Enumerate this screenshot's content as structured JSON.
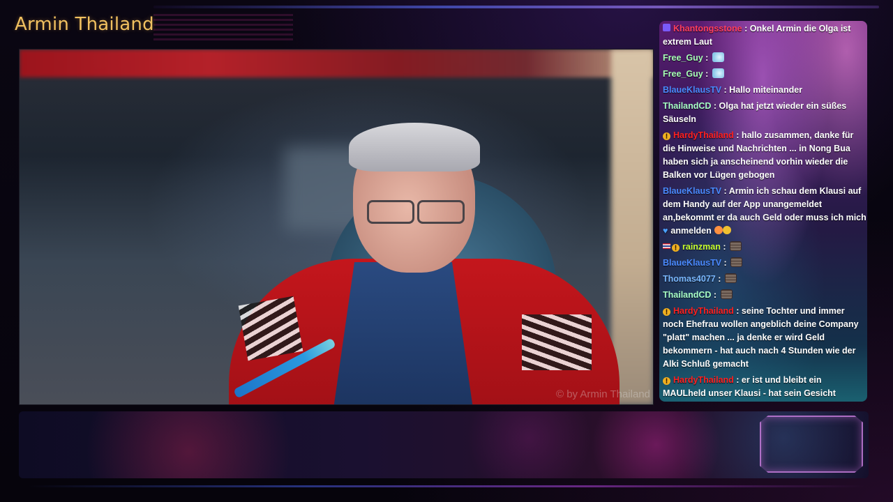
{
  "stream": {
    "title": "Armin Thailand",
    "watermark": "© by Armin Thailand"
  },
  "chat": {
    "messages": [
      {
        "user": "Khantongsstone",
        "color": "#ff3e5e",
        "badges": [
          "twitch-icon"
        ],
        "text": " : Onkel Armin die Olga ist extrem Laut",
        "emotes": []
      },
      {
        "user": "Free_Guy",
        "color": "#a8ffb8",
        "badges": [],
        "text": " : ",
        "emotes": [
          "ghost-emote"
        ]
      },
      {
        "user": "Free_Guy",
        "color": "#a8ffb8",
        "badges": [],
        "text": " : ",
        "emotes": [
          "ghost-emote"
        ]
      },
      {
        "user": "BlaueKlausTV",
        "color": "#4a8aff",
        "badges": [],
        "text": " : Hallo miteinander",
        "emotes": []
      },
      {
        "user": "ThailandCD",
        "color": "#a8ffc8",
        "badges": [],
        "text": " : Olga hat jetzt wieder ein süßes Säuseln",
        "emotes": []
      },
      {
        "user": "HardyThailand",
        "color": "#ff2020",
        "badges": [
          "sub-badge"
        ],
        "text": " : hallo zusammen, danke für die Hinweise und Nachrichten ... in Nong Bua haben sich ja anscheinend vorhin wieder die Balken vor Lügen gebogen",
        "emotes": []
      },
      {
        "user": "BlaueKlausTV",
        "color": "#4a8aff",
        "badges": [],
        "text": " : Armin ich schau dem Klausi auf dem Handy auf der App unangemeldet an,bekommt er da auch Geld oder muss ich mich anmelden",
        "emotes": [
          "heart-eyes-emoji",
          "blue-heart-emoji",
          "smile-emoji"
        ]
      },
      {
        "user": "rainzman",
        "color": "#c8ff30",
        "badges": [
          "thai-flag",
          "sub-badge"
        ],
        "text": " : ",
        "emotes": [
          "brick-emote"
        ]
      },
      {
        "user": "BlaueKlausTV",
        "color": "#4a8aff",
        "badges": [],
        "text": " : ",
        "emotes": [
          "brick-emote"
        ]
      },
      {
        "user": "Thomas4077",
        "color": "#7ab8ff",
        "badges": [],
        "text": " : ",
        "emotes": [
          "brick-emote"
        ]
      },
      {
        "user": "ThailandCD",
        "color": "#a8ffc8",
        "badges": [],
        "text": " : ",
        "emotes": [
          "brick-emote"
        ]
      },
      {
        "user": "HardyThailand",
        "color": "#ff2020",
        "badges": [
          "sub-badge"
        ],
        "text": " : seine Tochter und immer noch Ehefrau wollen angeblich deine Company \"platt\" machen ... ja denke er wird Geld bekommern - hat auch nach 4 Stunden wie der Alki Schluß gemacht",
        "emotes": []
      },
      {
        "user": "HardyThailand",
        "color": "#ff2020",
        "badges": [
          "sub-badge"
        ],
        "text": " : er ist und bleibt ein MAULheld unser Klausi - hat sein Gesicht verloren dass der angebliche Einzelkämpfer eine \"Flasche\" ist",
        "emotes": []
      }
    ]
  },
  "colors": {
    "title": "#f0c060",
    "chat_text": "#ffffff",
    "frame_bg": "#06040c"
  }
}
